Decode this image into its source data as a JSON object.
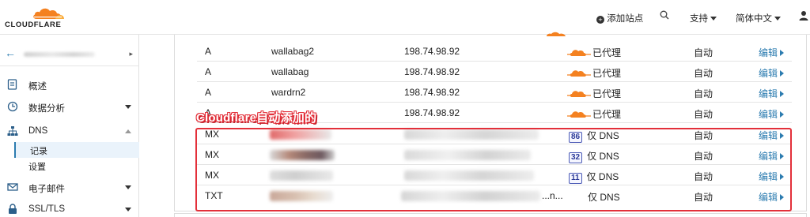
{
  "brand": {
    "logo_text": "CLOUDFLARE",
    "cloud_color": "#f48120"
  },
  "header": {
    "add_site": "添加站点",
    "support": "支持",
    "language": "简体中文"
  },
  "sidebar": {
    "items": [
      {
        "label": "概述",
        "icon": "document-icon"
      },
      {
        "label": "数据分析",
        "icon": "clock-chart-icon"
      },
      {
        "label": "DNS",
        "icon": "network-icon"
      },
      {
        "label": "电子邮件",
        "icon": "email-icon"
      },
      {
        "label": "SSL/TLS",
        "icon": "lock-icon"
      }
    ],
    "dns_sub": [
      "记录",
      "设置"
    ]
  },
  "annotation": {
    "label": "Cloudflare自动添加的",
    "color": "#e3303a"
  },
  "records": [
    {
      "type": "A",
      "name": "wallabag2",
      "content": "198.74.98.92",
      "proxy": "已代理",
      "ttl": "自动",
      "edit": "编辑"
    },
    {
      "type": "A",
      "name": "wallabag",
      "content": "198.74.98.92",
      "proxy": "已代理",
      "ttl": "自动",
      "edit": "编辑"
    },
    {
      "type": "A",
      "name": "wardrn2",
      "content": "198.74.98.92",
      "proxy": "已代理",
      "ttl": "自动",
      "edit": "编辑"
    },
    {
      "type": "A",
      "name": "",
      "content": "198.74.98.92",
      "proxy": "已代理",
      "ttl": "自动",
      "edit": "编辑"
    },
    {
      "type": "MX",
      "name": "",
      "content": "",
      "priority": "86",
      "proxy": "仅 DNS",
      "ttl": "自动",
      "edit": "编辑"
    },
    {
      "type": "MX",
      "name": "",
      "content": "",
      "priority": "32",
      "proxy": "仅 DNS",
      "ttl": "自动",
      "edit": "编辑"
    },
    {
      "type": "MX",
      "name": "",
      "content": "",
      "priority": "11",
      "proxy": "仅 DNS",
      "ttl": "自动",
      "edit": "编辑"
    },
    {
      "type": "TXT",
      "name": "",
      "content": "...n...",
      "proxy": "仅 DNS",
      "ttl": "自动",
      "edit": "编辑"
    }
  ]
}
